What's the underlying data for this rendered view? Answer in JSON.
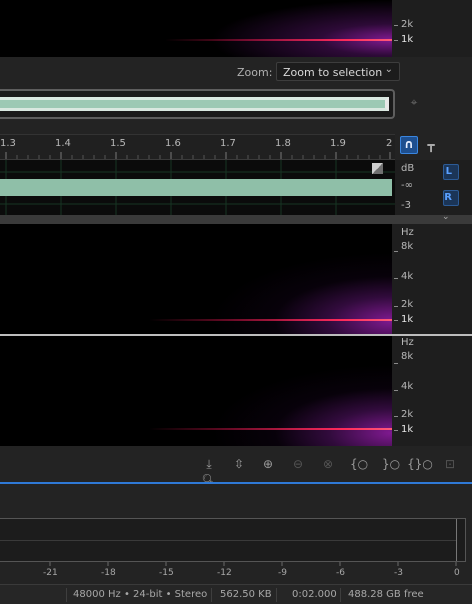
{
  "top_spectrogram": {
    "freq_labels": [
      "2k",
      "1k"
    ]
  },
  "zoom": {
    "label": "Zoom:",
    "value": "Zoom to selection"
  },
  "ruler": {
    "ticks": [
      "1.3",
      "1.4",
      "1.5",
      "1.6",
      "1.7",
      "1.8",
      "1.9",
      "2"
    ]
  },
  "amplitude": {
    "unit": "dB",
    "labels": [
      "-∞",
      "-3"
    ]
  },
  "channels": {
    "left": "L",
    "right": "R"
  },
  "spectrogram_left": {
    "unit": "Hz",
    "labels": [
      "8k",
      "4k",
      "2k",
      "1k"
    ]
  },
  "spectrogram_right": {
    "unit": "Hz",
    "labels": [
      "8k",
      "4k",
      "2k",
      "1k"
    ]
  },
  "meter": {
    "labels": [
      "-21",
      "-18",
      "-15",
      "-12",
      "-9",
      "-6",
      "-3",
      "0"
    ]
  },
  "status": {
    "format": "48000 Hz • 24-bit • Stereo",
    "size": "562.50 KB",
    "duration": "0:02.000",
    "free": "488.28 GB free"
  },
  "colors": {
    "waveform": "#8fbfa8",
    "accent": "#2f79d6",
    "spectral_line": "#ff2a5a",
    "spectral_glow": "#9a1faa"
  }
}
